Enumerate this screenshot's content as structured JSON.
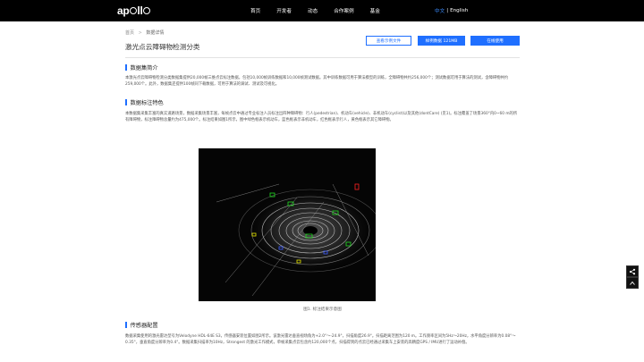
{
  "nav": {
    "logo": "apollo",
    "items": [
      "首页",
      "开发者",
      "动态",
      "合作案例",
      "基金"
    ],
    "lang_active": "中文",
    "lang_sep": "|",
    "lang_other": "English"
  },
  "breadcrumb": {
    "home": "首页",
    "sep": ">",
    "current": "数据详情"
  },
  "page_title": "激光点云障碍物检测分类",
  "buttons": {
    "demo": "查看示例文件",
    "download": "样例数据 121MB",
    "apply": "在线使用"
  },
  "sections": {
    "intro_title": "数据集简介",
    "intro_text": "本激光点云障碍物检测分类数据集提供20,000帧三维点云标注数据，包括10,000帧训练数据和10,000帧测试数据。其中训练数据可用于算法模型的训练，全障碍物共约256,000个；测试数据可用于算法的测试，含障碍物共约259,000个。此外，数据集还提供100帧同下载数据，可用于算法的调试、测试及可视化。",
    "feature_title": "数据标注特色",
    "feature_text": "本数据集采集丰富的真实道路场景，数据采集场景丰富，每帧点云中通过专业标注人员标注出四种障碍物：行人(pedestrian)、机动车(vehicle)、非机动车(cyclist)以及其他(dontCare) (见1)。标注覆盖了场景360°内0~60 m的所有障碍物，标注障碍物总量约为475,000个。标注结果如图1所示，图中绿色框表示机动车，蓝色框表示非机动车，红色框表示行人，黄色框表示其它障碍物。",
    "caption": "图1. 标注结果示意图",
    "sensor_title": "传感器配置",
    "sensor_text": "数据采集使用的激光雷达型号为Velodyne HDL-64E S3，传感器安装位置如图2所示。该激光雷达垂直视场角为+2.0°～-24.9°，扫描角度26.9°。扫描距离范围为120 m。工作频率区间为5Hz～20Hz，水平角度分辨率为0.08°～0.35°，垂直角度分辨率为0.4°。数据采集扫描率为10Hz，Strongest 的激光工作模式，单帧采集点云包含约120,000个点，扫描得到的点云已经通过采集车上安装的高精度GPS / IMU进行了运动补偿。"
  },
  "side": {
    "share_icon": "share-icon",
    "top_icon": "up-arrow-icon"
  },
  "colors": {
    "accent": "#1f6fff",
    "nav_bg": "#000000",
    "lang_active": "#3b8cff"
  }
}
